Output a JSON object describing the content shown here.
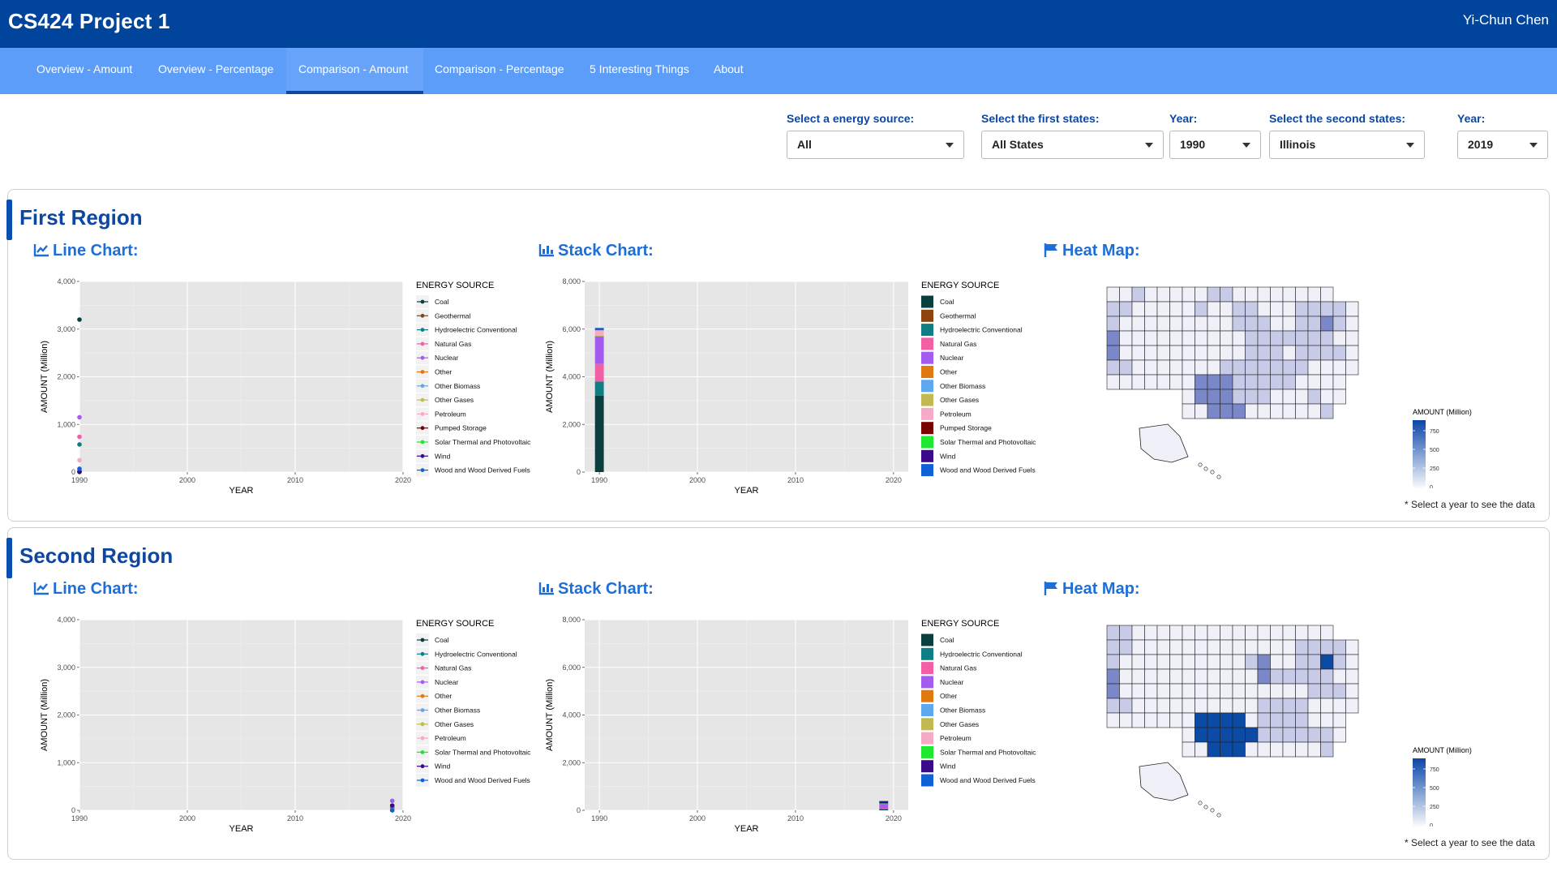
{
  "header": {
    "title": "CS424 Project 1",
    "user": "Yi-Chun Chen"
  },
  "nav": {
    "tabs": [
      {
        "label": "Overview - Amount",
        "active": false
      },
      {
        "label": "Overview - Percentage",
        "active": false
      },
      {
        "label": "Comparison - Amount",
        "active": true
      },
      {
        "label": "Comparison - Percentage",
        "active": false
      },
      {
        "label": "5 Interesting Things",
        "active": false
      },
      {
        "label": "About",
        "active": false
      }
    ]
  },
  "controls": {
    "energy": {
      "label": "Select a energy source:",
      "value": "All"
    },
    "first_states": {
      "label": "Select the first states:",
      "value": "All States"
    },
    "year1": {
      "label": "Year:",
      "value": "1990"
    },
    "second_states": {
      "label": "Select the second states:",
      "value": "Illinois"
    },
    "year2": {
      "label": "Year:",
      "value": "2019"
    }
  },
  "panels": [
    {
      "title": "First Region",
      "line_title": "Line Chart:",
      "stack_title": "Stack Chart:",
      "map_title": "Heat Map:",
      "map_note": "* Select a year to see the data",
      "map_legend_title": "AMOUNT (Million)"
    },
    {
      "title": "Second Region",
      "line_title": "Line Chart:",
      "stack_title": "Stack Chart:",
      "map_title": "Heat Map:",
      "map_note": "* Select a year to see the data",
      "map_legend_title": "AMOUNT (Million)"
    }
  ],
  "colors": {
    "Coal": "#0b3f3f",
    "Geothermal": "#8c4510",
    "Hydroelectric Conventional": "#0e7e84",
    "Natural Gas": "#f25fa5",
    "Nuclear": "#a45cf0",
    "Other": "#e07a10",
    "Other Biomass": "#5fa8f0",
    "Other Gases": "#c2b950",
    "Petroleum": "#f7a9c8",
    "Pumped Storage": "#7a0000",
    "Solar Thermal and Photovoltaic": "#1ee830",
    "Wind": "#3a0a8a",
    "Wood and Wood Derived Fuels": "#1060d8",
    "map_low": "#f1f1fa",
    "map_high": "#0a46a8",
    "header_bg": "#01449c",
    "nav_bg": "#5b9df9"
  },
  "chart_data": [
    {
      "id": "line1",
      "type": "line",
      "xlabel": "YEAR",
      "ylabel": "AMOUNT (Million)",
      "xlim": [
        1990,
        2020
      ],
      "ylim": [
        0,
        4000
      ],
      "xticks": [
        1990,
        2000,
        2010,
        2020
      ],
      "yticks": [
        0,
        1000,
        2000,
        3000,
        4000
      ],
      "legend_title": "ENERGY SOURCE",
      "series": [
        {
          "name": "Coal",
          "x": [
            1990
          ],
          "y": [
            3200
          ]
        },
        {
          "name": "Geothermal",
          "x": [
            1990
          ],
          "y": [
            20
          ]
        },
        {
          "name": "Hydroelectric Conventional",
          "x": [
            1990
          ],
          "y": [
            580
          ]
        },
        {
          "name": "Natural Gas",
          "x": [
            1990
          ],
          "y": [
            740
          ]
        },
        {
          "name": "Nuclear",
          "x": [
            1990
          ],
          "y": [
            1150
          ]
        },
        {
          "name": "Other",
          "x": [
            1990
          ],
          "y": [
            10
          ]
        },
        {
          "name": "Other Biomass",
          "x": [
            1990
          ],
          "y": [
            15
          ]
        },
        {
          "name": "Other Gases",
          "x": [
            1990
          ],
          "y": [
            5
          ]
        },
        {
          "name": "Petroleum",
          "x": [
            1990
          ],
          "y": [
            250
          ]
        },
        {
          "name": "Pumped Storage",
          "x": [
            1990
          ],
          "y": [
            5
          ]
        },
        {
          "name": "Solar Thermal and Photovoltaic",
          "x": [
            1990
          ],
          "y": [
            2
          ]
        },
        {
          "name": "Wind",
          "x": [
            1990
          ],
          "y": [
            5
          ]
        },
        {
          "name": "Wood and Wood Derived Fuels",
          "x": [
            1990
          ],
          "y": [
            70
          ]
        }
      ]
    },
    {
      "id": "stack1",
      "type": "bar",
      "stacked": true,
      "xlabel": "YEAR",
      "ylabel": "AMOUNT (Million)",
      "xlim": [
        1988.5,
        2021.5
      ],
      "ylim": [
        0,
        8000
      ],
      "xticks": [
        1990,
        2000,
        2010,
        2020
      ],
      "yticks": [
        0,
        2000,
        4000,
        6000,
        8000
      ],
      "legend_title": "ENERGY SOURCE",
      "categories": [
        1990
      ],
      "series": [
        {
          "name": "Coal",
          "values": [
            3200
          ]
        },
        {
          "name": "Geothermal",
          "values": [
            20
          ]
        },
        {
          "name": "Hydroelectric Conventional",
          "values": [
            580
          ]
        },
        {
          "name": "Natural Gas",
          "values": [
            740
          ]
        },
        {
          "name": "Nuclear",
          "values": [
            1150
          ]
        },
        {
          "name": "Other",
          "values": [
            10
          ]
        },
        {
          "name": "Other Biomass",
          "values": [
            15
          ]
        },
        {
          "name": "Other Gases",
          "values": [
            5
          ]
        },
        {
          "name": "Petroleum",
          "values": [
            250
          ]
        },
        {
          "name": "Pumped Storage",
          "values": [
            5
          ]
        },
        {
          "name": "Solar Thermal and Photovoltaic",
          "values": [
            2
          ]
        },
        {
          "name": "Wind",
          "values": [
            5
          ]
        },
        {
          "name": "Wood and Wood Derived Fuels",
          "values": [
            70
          ]
        }
      ]
    },
    {
      "id": "line2",
      "type": "line",
      "xlabel": "YEAR",
      "ylabel": "AMOUNT (Million)",
      "xlim": [
        1990,
        2020
      ],
      "ylim": [
        0,
        4000
      ],
      "xticks": [
        1990,
        2000,
        2010,
        2020
      ],
      "yticks": [
        0,
        1000,
        2000,
        3000,
        4000
      ],
      "legend_title": "ENERGY SOURCE",
      "series": [
        {
          "name": "Coal",
          "x": [
            2019
          ],
          "y": [
            50
          ]
        },
        {
          "name": "Hydroelectric Conventional",
          "x": [
            2019
          ],
          "y": [
            1
          ]
        },
        {
          "name": "Natural Gas",
          "x": [
            2019
          ],
          "y": [
            35
          ]
        },
        {
          "name": "Nuclear",
          "x": [
            2019
          ],
          "y": [
            200
          ]
        },
        {
          "name": "Other",
          "x": [
            2019
          ],
          "y": [
            1
          ]
        },
        {
          "name": "Other Biomass",
          "x": [
            2019
          ],
          "y": [
            1
          ]
        },
        {
          "name": "Other Gases",
          "x": [
            2019
          ],
          "y": [
            1
          ]
        },
        {
          "name": "Petroleum",
          "x": [
            2019
          ],
          "y": [
            1
          ]
        },
        {
          "name": "Solar Thermal and Photovoltaic",
          "x": [
            2019
          ],
          "y": [
            1
          ]
        },
        {
          "name": "Wind",
          "x": [
            2019
          ],
          "y": [
            100
          ]
        },
        {
          "name": "Wood and Wood Derived Fuels",
          "x": [
            2019
          ],
          "y": [
            1
          ]
        }
      ]
    },
    {
      "id": "stack2",
      "type": "bar",
      "stacked": true,
      "xlabel": "YEAR",
      "ylabel": "AMOUNT (Million)",
      "xlim": [
        1988.5,
        2021.5
      ],
      "ylim": [
        0,
        8000
      ],
      "xticks": [
        1990,
        2000,
        2010,
        2020
      ],
      "yticks": [
        0,
        2000,
        4000,
        6000,
        8000
      ],
      "legend_title": "ENERGY SOURCE",
      "categories": [
        2019
      ],
      "series": [
        {
          "name": "Coal",
          "values": [
            50
          ]
        },
        {
          "name": "Hydroelectric Conventional",
          "values": [
            1
          ]
        },
        {
          "name": "Natural Gas",
          "values": [
            35
          ]
        },
        {
          "name": "Nuclear",
          "values": [
            200
          ]
        },
        {
          "name": "Other",
          "values": [
            1
          ]
        },
        {
          "name": "Other Biomass",
          "values": [
            1
          ]
        },
        {
          "name": "Other Gases",
          "values": [
            1
          ]
        },
        {
          "name": "Petroleum",
          "values": [
            1
          ]
        },
        {
          "name": "Solar Thermal and Photovoltaic",
          "values": [
            1
          ]
        },
        {
          "name": "Wind",
          "values": [
            100
          ]
        },
        {
          "name": "Wood and Wood Derived Fuels",
          "values": [
            1
          ]
        }
      ]
    }
  ],
  "heatmaps": [
    {
      "legend_ticks": [
        "750",
        "500",
        "250",
        "0"
      ]
    },
    {
      "legend_ticks": [
        "750",
        "500",
        "250",
        "0"
      ]
    }
  ]
}
